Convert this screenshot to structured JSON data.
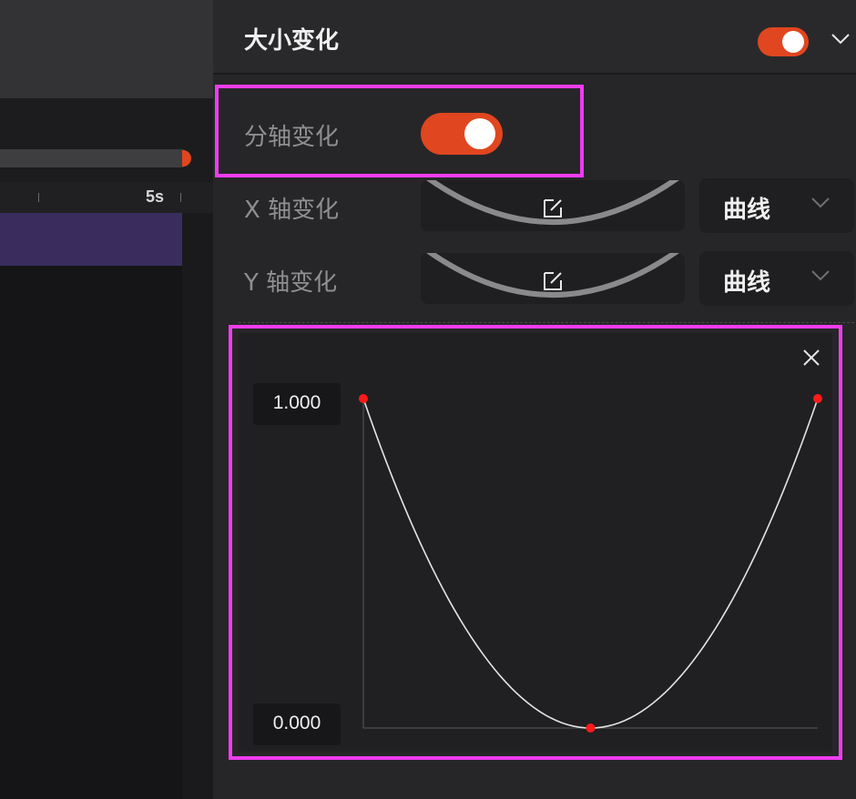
{
  "timeline": {
    "ruler_label": "5s"
  },
  "panel": {
    "title": "大小变化",
    "title_toggle_on": true,
    "split_axis": {
      "label": "分轴变化",
      "on": true
    },
    "x_axis": {
      "label": "X 轴变化",
      "mode": "曲线"
    },
    "y_axis": {
      "label": "Y 轴变化",
      "mode": "曲线"
    }
  },
  "curve_editor": {
    "max_label": "1.000",
    "min_label": "0.000",
    "keyframes": [
      {
        "t": 0.0,
        "v": 1.0
      },
      {
        "t": 0.5,
        "v": 0.0
      },
      {
        "t": 1.0,
        "v": 1.0
      }
    ]
  },
  "colors": {
    "accent": "#e0461f",
    "highlight": "#f03cf0",
    "keyframe": "#ff1a1a"
  },
  "icons": {
    "edit": "edit-icon",
    "chevron": "chevron-down-icon",
    "close": "close-icon"
  }
}
